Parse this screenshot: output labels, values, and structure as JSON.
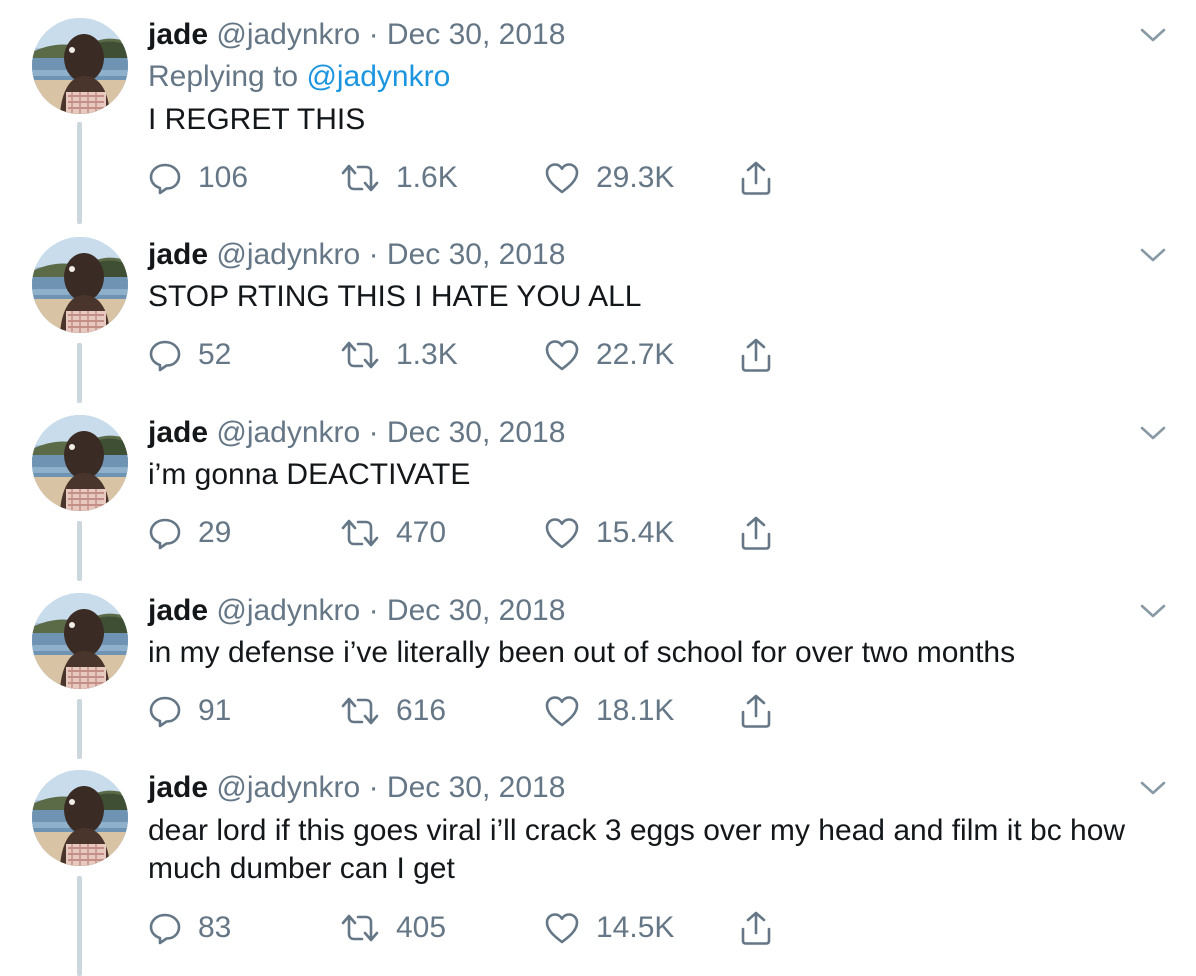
{
  "tweets": [
    {
      "name": "jade",
      "handle": "@jadynkro",
      "sep": "·",
      "date": "Dec 30, 2018",
      "replying_prefix": "Replying to",
      "replying_to": "@jadynkro",
      "text": "I REGRET THIS",
      "replies": "106",
      "retweets": "1.6K",
      "likes": "29.3K"
    },
    {
      "name": "jade",
      "handle": "@jadynkro",
      "sep": "·",
      "date": "Dec 30, 2018",
      "text": "STOP RTING THIS I HATE YOU ALL",
      "replies": "52",
      "retweets": "1.3K",
      "likes": "22.7K"
    },
    {
      "name": "jade",
      "handle": "@jadynkro",
      "sep": "·",
      "date": "Dec 30, 2018",
      "text": "i’m gonna DEACTIVATE",
      "replies": "29",
      "retweets": "470",
      "likes": "15.4K"
    },
    {
      "name": "jade",
      "handle": "@jadynkro",
      "sep": "·",
      "date": "Dec 30, 2018",
      "text": "in my defense i’ve literally been out of school for over two months",
      "replies": "91",
      "retweets": "616",
      "likes": "18.1K"
    },
    {
      "name": "jade",
      "handle": "@jadynkro",
      "sep": "·",
      "date": "Dec 30, 2018",
      "text": "dear lord if this goes viral i’ll crack 3 eggs over my head and film it bc how much dumber can I get",
      "replies": "83",
      "retweets": "405",
      "likes": "14.5K"
    }
  ],
  "icons": {
    "reply": "reply-icon",
    "retweet": "retweet-icon",
    "like": "heart-icon",
    "share": "share-icon",
    "menu": "chevron-down-icon"
  },
  "colors": {
    "text": "#14171a",
    "secondary": "#657786",
    "link": "#1b95e0",
    "thread_line": "#ccd6dd"
  }
}
